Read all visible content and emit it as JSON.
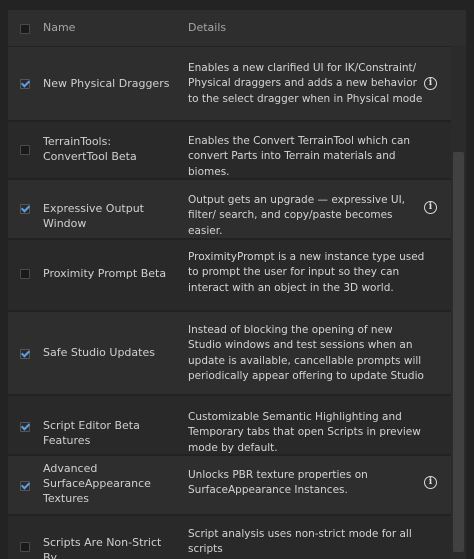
{
  "header": {
    "name_label": "Name",
    "details_label": "Details"
  },
  "rows": [
    {
      "checked": true,
      "name": "New Physical Draggers",
      "details": "Enables a new clarified UI for IK/Constraint/ Physical draggers and adds a new behavior to the select dragger when in Physical mode",
      "info": true
    },
    {
      "checked": false,
      "name": "TerrainTools: ConvertTool Beta",
      "details": "Enables the Convert TerrainTool which can convert Parts into Terrain materials and biomes.",
      "info": false
    },
    {
      "checked": true,
      "name": "Expressive Output Window",
      "details": "Output gets an upgrade — expressive UI, filter/ search, and copy/paste becomes easier.",
      "info": true
    },
    {
      "checked": false,
      "name": "Proximity Prompt Beta",
      "details": "ProximityPrompt is a new instance type used to prompt the user for input so they can interact with an object in the 3D world.",
      "info": false
    },
    {
      "checked": true,
      "name": "Safe Studio Updates",
      "details": "Instead of blocking the opening of new Studio windows and test sessions when an update is available, cancellable prompts will periodically appear offering to update Studio",
      "info": false
    },
    {
      "checked": true,
      "name": "Script Editor Beta Features",
      "details": "Customizable Semantic Highlighting and Temporary tabs that open Scripts in preview mode by default.",
      "info": false
    },
    {
      "checked": true,
      "name": "Advanced SurfaceAppearance Textures",
      "details": "Unlocks PBR texture properties on SurfaceAppearance Instances.",
      "info": true
    },
    {
      "checked": false,
      "name": "Scripts Are Non-Strict By",
      "details": "Script analysis uses non-strict mode for all scripts",
      "info": false
    }
  ],
  "icons": {
    "info": "info-circle-icon",
    "checkbox_checked": "checkmark-icon"
  },
  "colors": {
    "background": "#2e2e2e",
    "check_accent": "#5aa0e8"
  }
}
